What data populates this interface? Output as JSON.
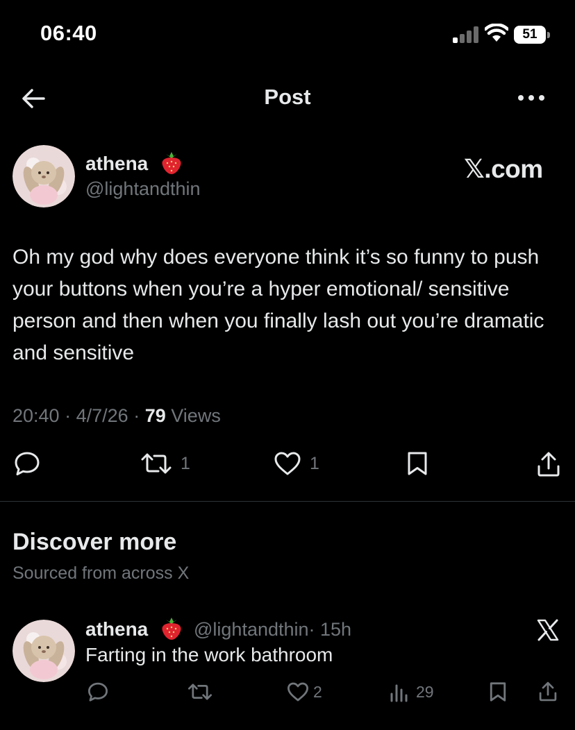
{
  "status_bar": {
    "time": "06:40",
    "battery": "51"
  },
  "nav": {
    "title": "Post",
    "back_icon": "arrow-left-icon",
    "more_icon": "more-horizontal-icon"
  },
  "post": {
    "author": {
      "name": "athena",
      "emoji": "🍓",
      "handle": "@lightandthin"
    },
    "watermark": "𝕏.com",
    "text": "Oh my god why does everyone think it’s so funny to push your buttons when you’re a hyper emotional/ sensitive person and then when you finally lash out you’re dramatic and sensitive",
    "time": "20:40",
    "date": "4/7/26",
    "views_count": "79",
    "views_label": "Views",
    "separator": "·",
    "actions": {
      "retweets": "1",
      "likes": "1"
    }
  },
  "discover": {
    "title": "Discover more",
    "subtitle": "Sourced from across X"
  },
  "related_post": {
    "author": {
      "name": "athena",
      "emoji": "🍓",
      "handle": "@lightandthin",
      "time": "· 15h"
    },
    "text": "Farting in the work bathroom",
    "actions": {
      "likes": "2",
      "views": "29"
    }
  },
  "colors": {
    "background": "#000000",
    "text": "#e7e9ea",
    "secondary": "#71767b",
    "divider": "#2f3336"
  }
}
